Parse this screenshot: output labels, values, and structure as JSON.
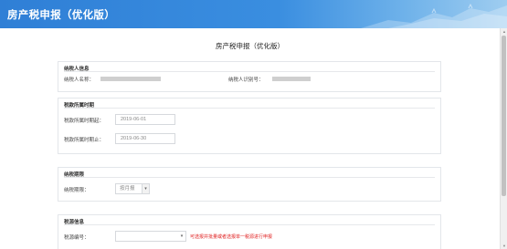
{
  "header": {
    "title": "房产税申报（优化版）"
  },
  "page": {
    "title": "房产税申报（优化版）"
  },
  "taxpayer": {
    "section_title": "纳税人信息",
    "name_label": "纳税人名称：",
    "id_label": "纳税人识别号："
  },
  "period": {
    "section_title": "税款所属时期",
    "start_label": "税款所属时期起：",
    "start_value": "2019-06-01",
    "end_label": "税款所属时期止：",
    "end_value": "2019-06-30"
  },
  "term": {
    "section_title": "纳税期限",
    "label": "纳税期限：",
    "selected": "按月报"
  },
  "source": {
    "section_title": "税源信息",
    "label": "税源编号：",
    "selected": "",
    "hint": "可选报并批量或者选报单一税源进行申报"
  }
}
